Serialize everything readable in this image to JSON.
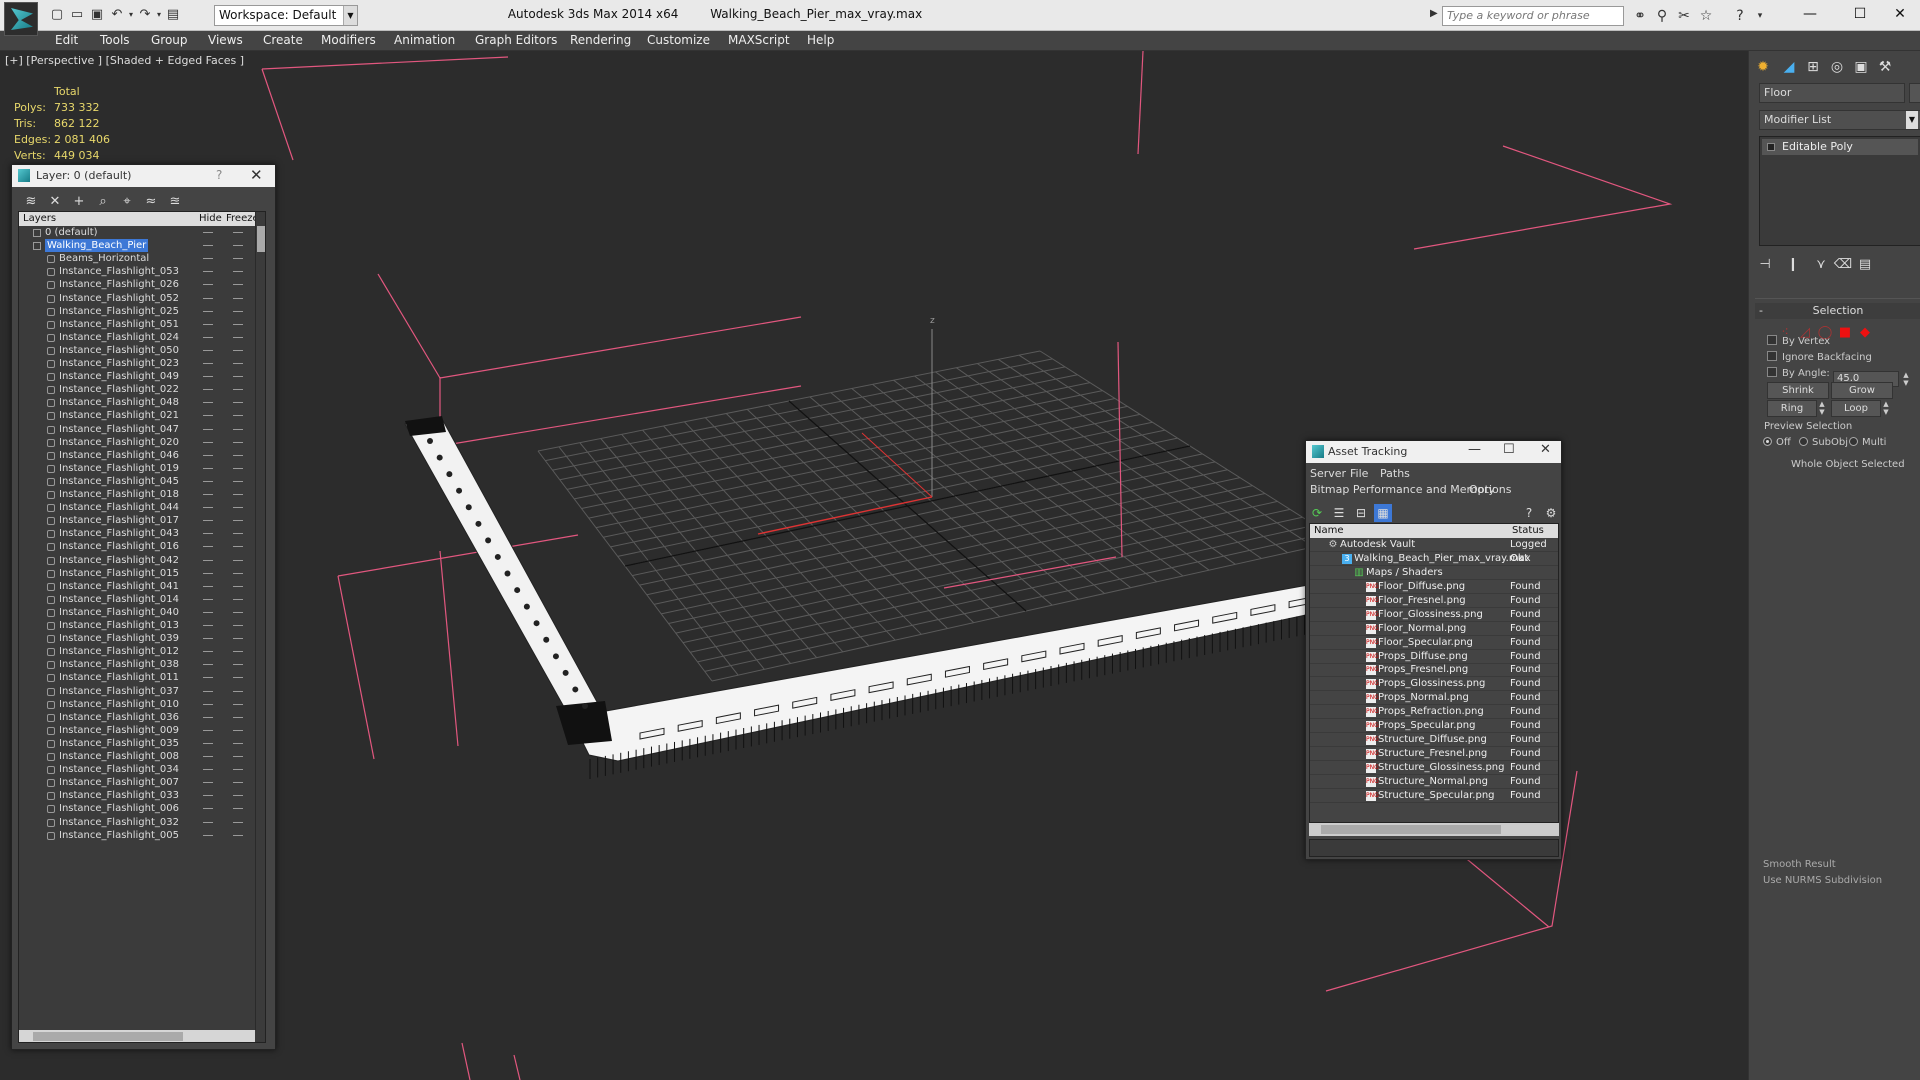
{
  "titlebar": {
    "workspace": "Workspace: Default",
    "app_name": "Autodesk 3ds Max  2014 x64",
    "file_name": "Walking_Beach_Pier_max_vray.max",
    "search_placeholder": "Type a keyword or phrase",
    "minimize": "—",
    "maximize": "☐",
    "close": "✕"
  },
  "menubar": {
    "items": [
      "Edit",
      "Tools",
      "Group",
      "Views",
      "Create",
      "Modifiers",
      "Animation",
      "Graph Editors",
      "Rendering",
      "Customize",
      "MAXScript",
      "Help"
    ]
  },
  "viewport": {
    "label": "[+] [Perspective ] [Shaded + Edged Faces ]",
    "stats": {
      "header": "Total",
      "polys_label": "Polys:",
      "polys": "733 332",
      "tris_label": "Tris:",
      "tris": "862 122",
      "edges_label": "Edges:",
      "edges": "2 081 406",
      "verts_label": "Verts:",
      "verts": "449 034"
    },
    "axis_z": "z",
    "bbox_color": "#e2577f"
  },
  "layer_dialog": {
    "title": "Layer: 0 (default)",
    "help": "?",
    "close": "✕",
    "columns": {
      "layers": "Layers",
      "hide": "Hide",
      "freeze": "Freeze"
    },
    "top_layers": [
      "0 (default)",
      "Walking_Beach_Pier"
    ],
    "objects": [
      "Beams_Horizontal",
      "Instance_Flashlight_053",
      "Instance_Flashlight_026",
      "Instance_Flashlight_052",
      "Instance_Flashlight_025",
      "Instance_Flashlight_051",
      "Instance_Flashlight_024",
      "Instance_Flashlight_050",
      "Instance_Flashlight_023",
      "Instance_Flashlight_049",
      "Instance_Flashlight_022",
      "Instance_Flashlight_048",
      "Instance_Flashlight_021",
      "Instance_Flashlight_047",
      "Instance_Flashlight_020",
      "Instance_Flashlight_046",
      "Instance_Flashlight_019",
      "Instance_Flashlight_045",
      "Instance_Flashlight_018",
      "Instance_Flashlight_044",
      "Instance_Flashlight_017",
      "Instance_Flashlight_043",
      "Instance_Flashlight_016",
      "Instance_Flashlight_042",
      "Instance_Flashlight_015",
      "Instance_Flashlight_041",
      "Instance_Flashlight_014",
      "Instance_Flashlight_040",
      "Instance_Flashlight_013",
      "Instance_Flashlight_039",
      "Instance_Flashlight_012",
      "Instance_Flashlight_038",
      "Instance_Flashlight_011",
      "Instance_Flashlight_037",
      "Instance_Flashlight_010",
      "Instance_Flashlight_036",
      "Instance_Flashlight_009",
      "Instance_Flashlight_035",
      "Instance_Flashlight_008",
      "Instance_Flashlight_034",
      "Instance_Flashlight_007",
      "Instance_Flashlight_033",
      "Instance_Flashlight_006",
      "Instance_Flashlight_032",
      "Instance_Flashlight_005"
    ]
  },
  "command_panel": {
    "object_name": "Floor",
    "modifier_list": "Modifier List",
    "stack_item": "Editable Poly",
    "selection_title": "Selection",
    "collapse": "-",
    "by_vertex": "By Vertex",
    "ignore_backfacing": "Ignore Backfacing",
    "by_angle": "By Angle:",
    "angle_value": "45.0",
    "shrink": "Shrink",
    "grow": "Grow",
    "ring": "Ring",
    "loop": "Loop",
    "preview_selection": "Preview Selection",
    "off": "Off",
    "subobj": "SubObj",
    "multi": "Multi",
    "whole_object": "Whole Object Selected",
    "smooth_result": "Smooth Result",
    "use_nurms": "Use NURMS Subdivision"
  },
  "asset_tracking": {
    "title": "Asset Tracking",
    "menu": {
      "server": "Server",
      "file": "File",
      "paths": "Paths",
      "bitmap": "Bitmap Performance and Memory",
      "options": "Options"
    },
    "columns": {
      "name": "Name",
      "status": "Status"
    },
    "vault": {
      "name": "Autodesk Vault",
      "status": "Logged Out"
    },
    "file": {
      "name": "Walking_Beach_Pier_max_vray.max",
      "status": "Ok"
    },
    "maps": {
      "name": "Maps / Shaders",
      "status": ""
    },
    "png_badge": "PNG",
    "rows": [
      {
        "name": "Floor_Diffuse.png",
        "status": "Found"
      },
      {
        "name": "Floor_Fresnel.png",
        "status": "Found"
      },
      {
        "name": "Floor_Glossiness.png",
        "status": "Found"
      },
      {
        "name": "Floor_Normal.png",
        "status": "Found"
      },
      {
        "name": "Floor_Specular.png",
        "status": "Found"
      },
      {
        "name": "Props_Diffuse.png",
        "status": "Found"
      },
      {
        "name": "Props_Fresnel.png",
        "status": "Found"
      },
      {
        "name": "Props_Glossiness.png",
        "status": "Found"
      },
      {
        "name": "Props_Normal.png",
        "status": "Found"
      },
      {
        "name": "Props_Refraction.png",
        "status": "Found"
      },
      {
        "name": "Props_Specular.png",
        "status": "Found"
      },
      {
        "name": "Structure_Diffuse.png",
        "status": "Found"
      },
      {
        "name": "Structure_Fresnel.png",
        "status": "Found"
      },
      {
        "name": "Structure_Glossiness.png",
        "status": "Found"
      },
      {
        "name": "Structure_Normal.png",
        "status": "Found"
      },
      {
        "name": "Structure_Specular.png",
        "status": "Found"
      }
    ]
  }
}
